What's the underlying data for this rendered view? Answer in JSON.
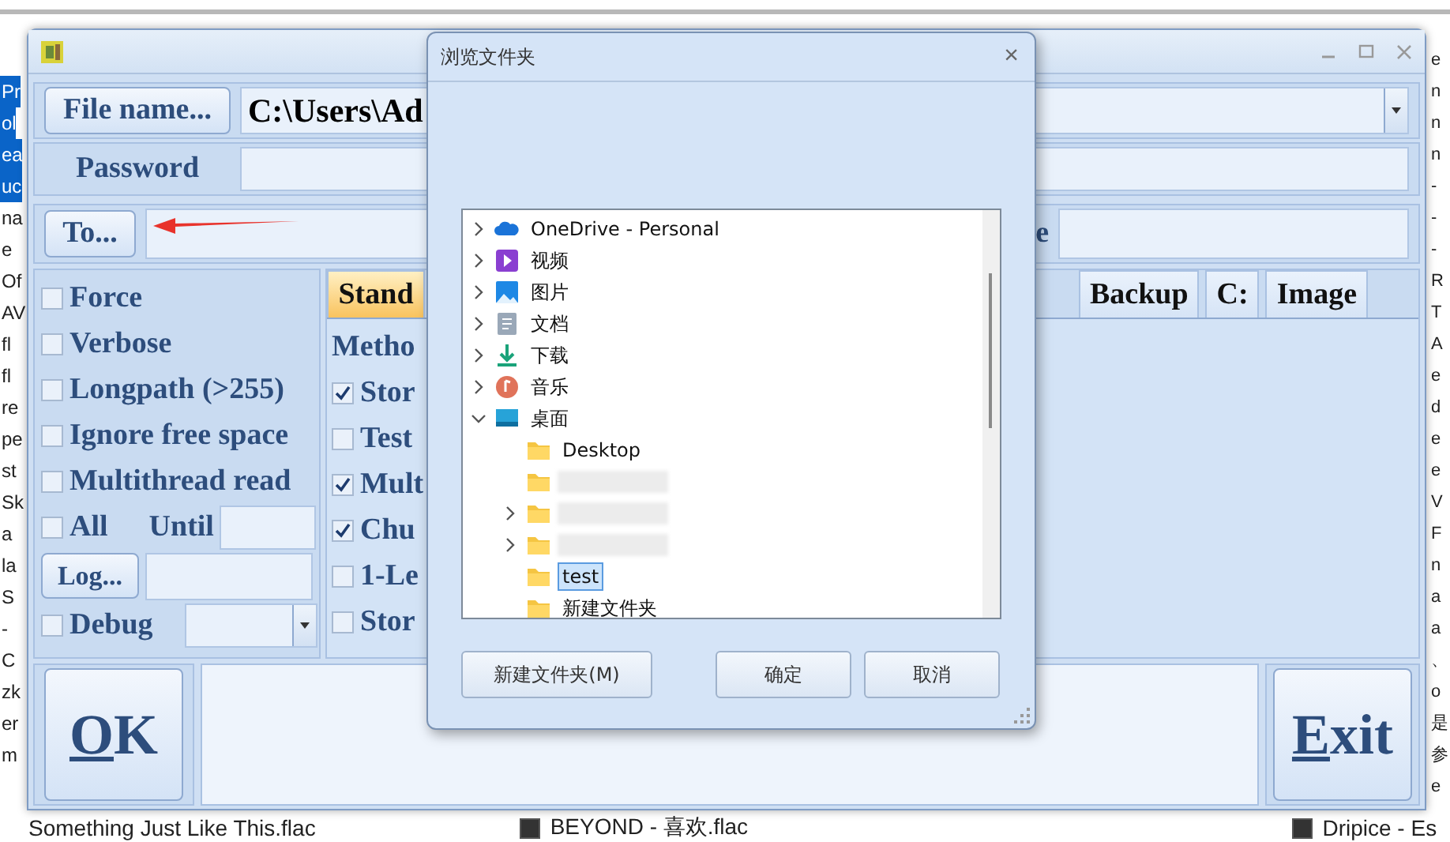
{
  "desktop": {
    "left_column": [
      {
        "text": "Pr",
        "selected": true
      },
      {
        "text": "ol",
        "selected": true
      },
      {
        "text": "ea",
        "selected": true
      },
      {
        "text": "uc",
        "selected": true
      },
      {
        "text": "na",
        "selected": false
      },
      {
        "text": "e",
        "selected": false
      },
      {
        "text": "Of",
        "selected": false
      },
      {
        "text": "AV",
        "selected": false
      },
      {
        "text": "fl",
        "selected": false
      },
      {
        "text": "fl",
        "selected": false
      },
      {
        "text": "re",
        "selected": false
      },
      {
        "text": "pe",
        "selected": false
      },
      {
        "text": "st",
        "selected": false
      },
      {
        "text": "Sk",
        "selected": false
      },
      {
        "text": "a",
        "selected": false
      },
      {
        "text": "la",
        "selected": false
      },
      {
        "text": "S",
        "selected": false
      },
      {
        "text": "-",
        "selected": false
      },
      {
        "text": "C",
        "selected": false
      },
      {
        "text": "zk",
        "selected": false
      },
      {
        "text": "er",
        "selected": false
      },
      {
        "text": "m",
        "selected": false
      }
    ],
    "right_column": [
      "e",
      "n",
      "n",
      "n",
      "-",
      "-",
      "-",
      "R",
      "T",
      "A",
      "e",
      "d",
      "e",
      "e",
      "V",
      "F",
      "n",
      "a",
      "a",
      "、",
      "o",
      "是",
      "参",
      "e"
    ],
    "bottom_row": [
      {
        "text": "Something Just Like This.flac",
        "kind": "plain"
      },
      {
        "text": "BEYOND - 喜欢.flac",
        "kind": "checkbox"
      },
      {
        "text": "Dripice - Es",
        "kind": "checkbox"
      }
    ]
  },
  "main_window": {
    "file_name_button": "File name...",
    "file_name_value": "C:\\Users\\Ad",
    "password_label": "Password",
    "to_button": "To...",
    "side_label": "e",
    "options": [
      {
        "label": "Force",
        "checked": false
      },
      {
        "label": "Verbose",
        "checked": false
      },
      {
        "label": "Longpath (>255)",
        "checked": false
      },
      {
        "label": "Ignore free space",
        "checked": false
      },
      {
        "label": "Multithread read",
        "checked": false
      }
    ],
    "all": {
      "label": "All",
      "checked": false,
      "until_label": "Until"
    },
    "log_button": "Log...",
    "debug": {
      "label": "Debug",
      "checked": false
    },
    "tabs": [
      {
        "label": "Stand",
        "selected": true
      },
      {
        "label": "Backup",
        "selected": false
      },
      {
        "label": "C:",
        "selected": false
      },
      {
        "label": "Image",
        "selected": false
      }
    ],
    "method_label": "Metho",
    "method_options": [
      {
        "label": "Stor",
        "checked": true
      },
      {
        "label": "Test",
        "checked": false
      },
      {
        "label": "Mult",
        "checked": true
      },
      {
        "label": "Chu",
        "checked": true
      },
      {
        "label": "1-Le",
        "checked": false
      },
      {
        "label": "Stor",
        "checked": false
      }
    ],
    "ok_button": "OK",
    "exit_button": "Exit"
  },
  "dialog": {
    "title": "浏览文件夹",
    "close": "×",
    "tree": [
      {
        "label": "OneDrive - Personal",
        "kind": "cloud",
        "expanded": false,
        "selected": false
      },
      {
        "label": "视频",
        "kind": "video",
        "expanded": false,
        "selected": false
      },
      {
        "label": "图片",
        "kind": "picture",
        "expanded": false,
        "selected": false
      },
      {
        "label": "文档",
        "kind": "document",
        "expanded": false,
        "selected": false
      },
      {
        "label": "下载",
        "kind": "download",
        "expanded": false,
        "selected": false
      },
      {
        "label": "音乐",
        "kind": "music",
        "expanded": false,
        "selected": false
      },
      {
        "label": "桌面",
        "kind": "desktop",
        "expanded": true,
        "selected": false,
        "children": [
          {
            "label": "Desktop",
            "kind": "folder",
            "selected": false
          },
          {
            "kind": "blurred"
          },
          {
            "kind": "blurred",
            "expanded": false
          },
          {
            "kind": "blurred",
            "expanded": false
          },
          {
            "label": "test",
            "kind": "folder",
            "selected": true
          },
          {
            "label": "新建文件夹",
            "kind": "folder",
            "selected": false
          }
        ]
      }
    ],
    "buttons": [
      "新建文件夹(M)",
      "确定",
      "取消"
    ]
  }
}
